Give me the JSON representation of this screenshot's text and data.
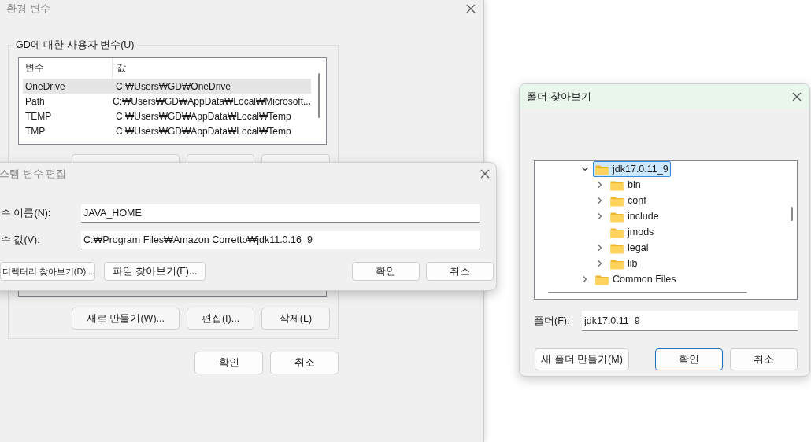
{
  "env_window": {
    "title": "환경 변수",
    "user_vars": {
      "title": "GD에 대한 사용자 변수(U)",
      "columns": [
        "변수",
        "값"
      ],
      "rows": [
        {
          "name": "OneDrive",
          "value": "C:₩Users₩GD₩OneDrive",
          "selected": true
        },
        {
          "name": "Path",
          "value": "C:₩Users₩GD₩AppData₩Local₩Microsoft...",
          "selected": false
        },
        {
          "name": "TEMP",
          "value": "C:₩Users₩GD₩AppData₩Local₩Temp",
          "selected": false
        },
        {
          "name": "TMP",
          "value": "C:₩Users₩GD₩AppData₩Local₩Temp",
          "selected": false
        }
      ]
    },
    "system_var_buttons": [
      "새로 만들기(W)...",
      "편집(I)...",
      "삭제(L)"
    ],
    "buttons": [
      "확인",
      "취소"
    ]
  },
  "edit_dialog": {
    "title": "스템 변수 편집",
    "fields": [
      {
        "label": "수 이름(N):",
        "value": "JAVA_HOME"
      },
      {
        "label": "수 값(V):",
        "value": "C:₩Program Files₩Amazon Corretto₩jdk11.0.16_9"
      }
    ],
    "left_buttons": [
      "디렉터리 찾아보기(D)...",
      "파일 찾아보기(F)..."
    ],
    "buttons": [
      "확인",
      "취소"
    ]
  },
  "folder_dialog": {
    "title": "폴더 찾아보기",
    "tree": [
      {
        "children": [
          {
            "label": "jdk17.0.11_9",
            "expandable": true,
            "expanded": true,
            "selected": true,
            "children": [
              {
                "label": "bin",
                "expandable": true,
                "expanded": false,
                "selected": false
              },
              {
                "label": "conf",
                "expandable": true,
                "expanded": false,
                "selected": false
              },
              {
                "label": "include",
                "expandable": true,
                "expanded": false,
                "selected": false
              },
              {
                "label": "jmods",
                "expandable": false,
                "selected": false
              },
              {
                "label": "legal",
                "expandable": true,
                "expanded": false,
                "selected": false
              },
              {
                "label": "lib",
                "expandable": true,
                "expanded": false,
                "selected": false
              }
            ]
          }
        ]
      },
      {
        "label": "Common Files",
        "expandable": true,
        "expanded": false,
        "selected": false
      }
    ],
    "folder_field": {
      "label": "폴더(F):",
      "value": "jdk17.0.11_9"
    },
    "buttons": [
      {
        "label": "새 폴더 만들기(M)",
        "default": false
      },
      {
        "label": "확인",
        "default": true
      },
      {
        "label": "취소",
        "default": false
      }
    ]
  }
}
